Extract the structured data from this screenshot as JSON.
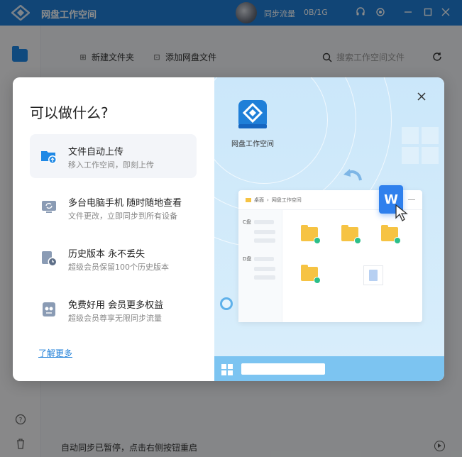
{
  "titlebar": {
    "app_title": "网盘工作空间",
    "sync_label": "同步流量",
    "sync_value": "0B/1G"
  },
  "toolbar": {
    "new_folder": "新建文件夹",
    "add_file": "添加网盘文件",
    "search_placeholder": "搜索工作空间文件"
  },
  "status": {
    "text": "自动同步已暂停，点击右侧按钮重启"
  },
  "modal": {
    "title": "可以做什么?",
    "features": [
      {
        "name": "文件自动上传",
        "desc": "移入工作空间，即刻上传",
        "icon": "upload-folder-icon"
      },
      {
        "name": "多台电脑手机 随时随地查看",
        "desc": "文件更改，立即同步到所有设备",
        "icon": "monitor-sync-icon"
      },
      {
        "name": "历史版本 永不丢失",
        "desc": "超级会员保留100个历史版本",
        "icon": "history-clock-icon"
      },
      {
        "name": "免费好用 会员更多权益",
        "desc": "超级会员尊享无限同步流量",
        "icon": "member-benefit-icon"
      }
    ],
    "learn_more": "了解更多",
    "illustration": {
      "app_label": "网盘工作空间",
      "breadcrumb": [
        "桌面",
        "网盘工作空间"
      ],
      "drives": [
        "C盘",
        "D盘"
      ],
      "file_letter": "W"
    }
  },
  "colors": {
    "brand": "#1f7fd8",
    "panel_bg": "#cbe7fa",
    "folder": "#f6c343",
    "check": "#2bbf8a"
  }
}
